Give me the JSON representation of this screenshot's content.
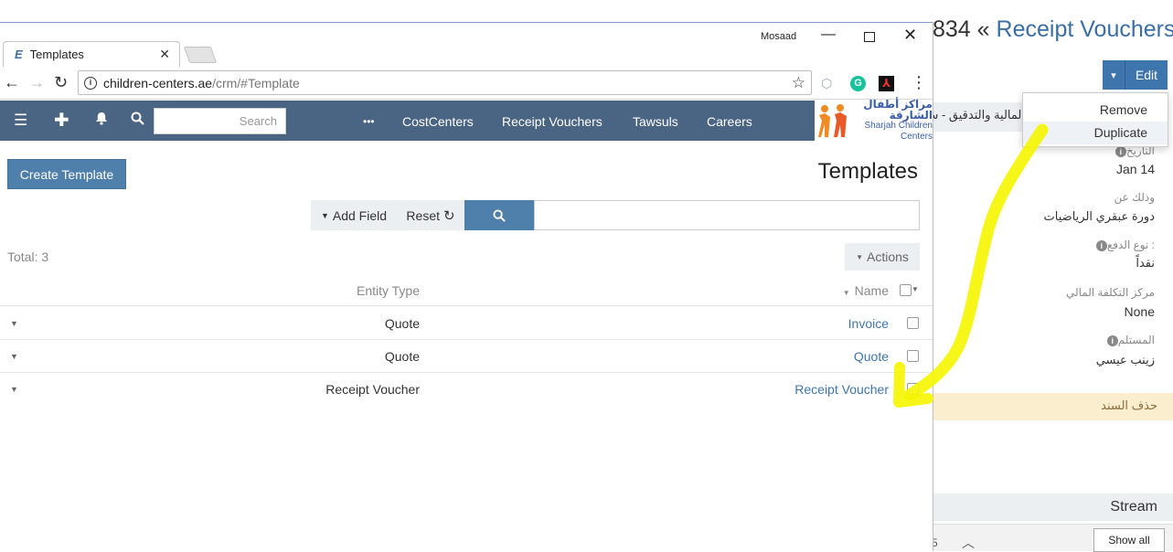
{
  "background_window": {
    "title_number": "834",
    "title_separator": "«",
    "title_crumb": "Receipt Vouchers",
    "edit_label": "Edit",
    "caret_label": "▾",
    "dropdown": {
      "remove": "Remove",
      "duplicate": "Duplicate"
    },
    "strip_text": "المالية والتدقيق - سـ",
    "fields": {
      "date_label": "التاريخ",
      "date_value": "Jan 14",
      "regarding_label": "وذلك عن",
      "regarding_value": "دورة عبقري الرياضيات",
      "payment_label": "نوع الدفع :",
      "payment_value": "نقداً",
      "cost_center_label": "مركز التكلفة المالي",
      "cost_center_value": "None",
      "recipient_label": "المستلم",
      "recipient_value": "زينب عيسي"
    },
    "delete_text": "حذف السند",
    "stream_label": "Stream",
    "show_all_label": "Show all",
    "bottom_number": "5"
  },
  "browser": {
    "tab_title": "Templates",
    "tab_favicon": "E",
    "user_name": "Mosaad",
    "url_host": "children-centers.ae",
    "url_path": "/crm/#Template",
    "icons": {
      "back": "back-arrow-icon",
      "forward": "forward-arrow-icon",
      "reload": "reload-icon",
      "star": "star-icon",
      "menu": "menu-dots-icon"
    }
  },
  "app_nav": {
    "search_placeholder": "Search",
    "more": "•••",
    "links": [
      "CostCenters",
      "Receipt Vouchers",
      "Tawsuls",
      "Careers"
    ],
    "logo_ar": "مراكز أطفال الشارقة",
    "logo_en": "Sharjah Children Centers",
    "brand_color": "#4a6483"
  },
  "content": {
    "create_button": "Create Template",
    "page_title": "Templates",
    "add_field": "Add Field",
    "reset": "Reset",
    "total": "Total: 3",
    "actions": "Actions",
    "headers": {
      "entity_type": "Entity Type",
      "name": "Name"
    },
    "rows": [
      {
        "entity_type": "Quote",
        "name": "Invoice"
      },
      {
        "entity_type": "Quote",
        "name": "Quote"
      },
      {
        "entity_type": "Receipt Voucher",
        "name": "Receipt Voucher"
      }
    ]
  },
  "annotation_color": "#f5f500"
}
